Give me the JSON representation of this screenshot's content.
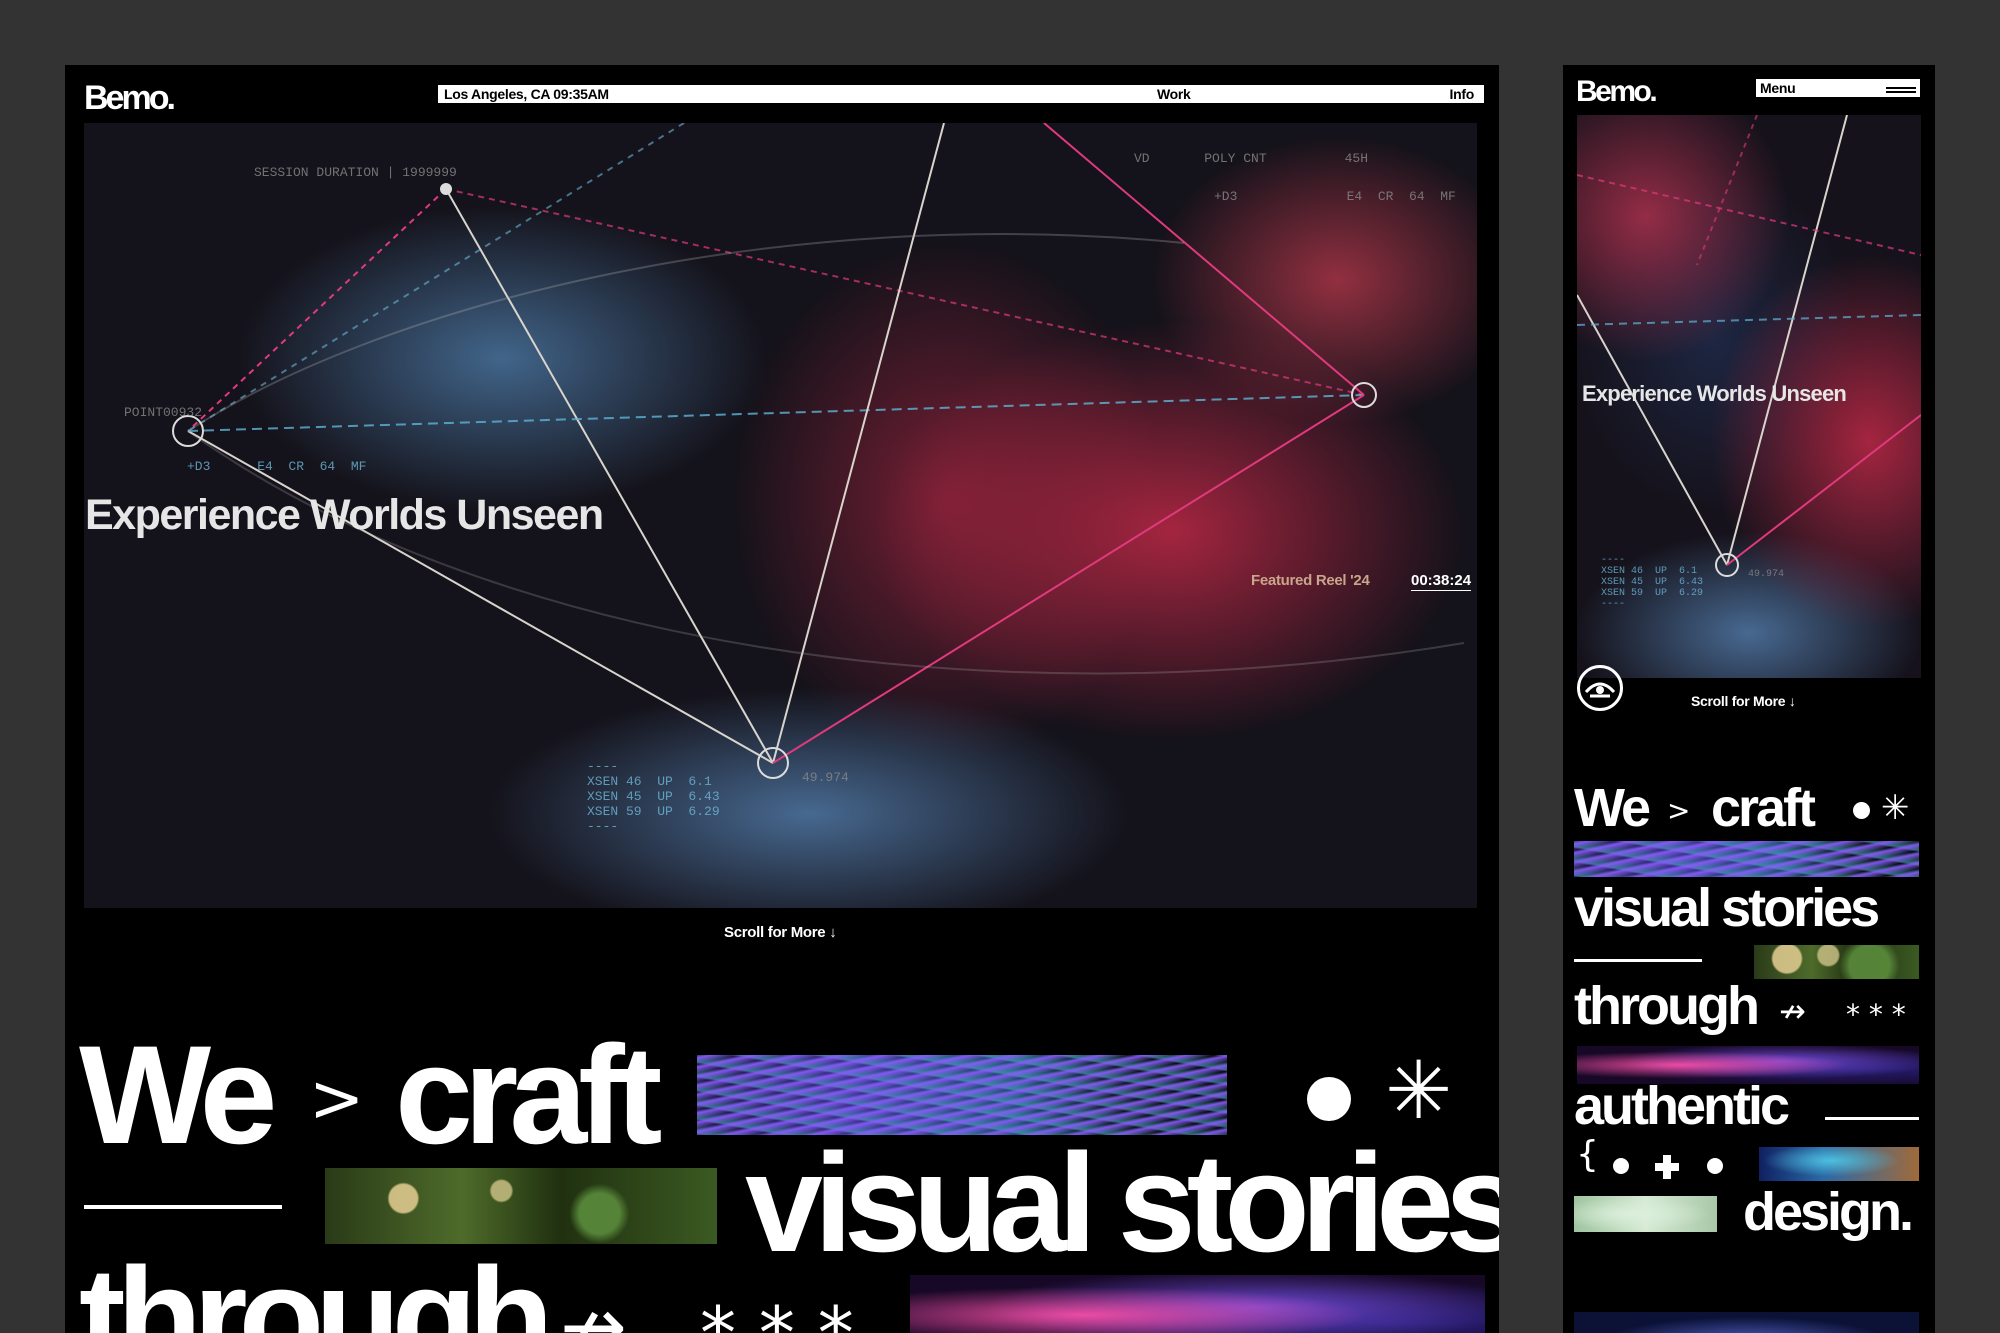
{
  "desktop": {
    "logo": "Bemo.",
    "nav": {
      "location_time": "Los Angeles, CA 09:35AM",
      "work": "Work",
      "info": "Info"
    },
    "hero": {
      "title": "Experience Worlds Unseen",
      "reel_label": "Featured Reel '24",
      "reel_time": "00:38:24",
      "hud": {
        "session": "SESSION DURATION | 1999999",
        "point": "POINT00932",
        "coords": "+D3      E4  CR  64  MF",
        "top_right_1": "VD       POLY CNT          45H",
        "top_right_2": "+D3              E4  CR  64  MF",
        "readout": "49.974",
        "xsen": "----\nXSEN 46  UP  6.1\nXSEN 45  UP  6.43\nXSEN 59  UP  6.29\n----"
      }
    },
    "scroll_label": "Scroll for More ↓",
    "statement": {
      "we": "We",
      "gt": ">",
      "craft": "craft",
      "asterisk": "✳",
      "visual_stories": "visual stories",
      "through": "through",
      "arrow": "↛",
      "stars": "* * *"
    }
  },
  "mobile": {
    "logo": "Bemo.",
    "menu": "Menu",
    "hero": {
      "title": "Experience Worlds Unseen",
      "readout": "49.974",
      "xsen": "----\nXSEN 46  UP  6.1\nXSEN 45  UP  6.43\nXSEN 59  UP  6.29\n----"
    },
    "scroll_label": "Scroll for More ↓",
    "statement": {
      "we": "We",
      "gt": ">",
      "craft": "craft",
      "asterisk": "✳",
      "visual_stories": "visual stories",
      "through": "through",
      "arrow": "↛",
      "stars": "* * *",
      "authentic": "authentic",
      "brace": "{",
      "design": "design."
    }
  },
  "colors": {
    "background": "#333333",
    "frame": "#000000",
    "text": "#ffffff",
    "reel_label": "#c9a58b"
  },
  "icons": [
    "menu-icon",
    "eye-logo-icon",
    "asterisk-icon",
    "arrow-icon"
  ]
}
